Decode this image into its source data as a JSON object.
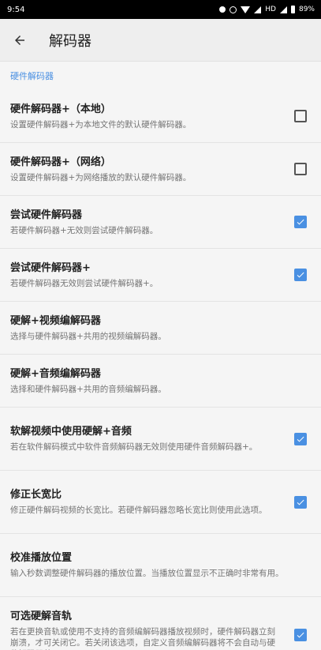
{
  "status_bar": {
    "time": "9:54",
    "network": "HD",
    "battery": "89%"
  },
  "app_bar": {
    "title": "解码器"
  },
  "section": {
    "header": "硬件解码器"
  },
  "colors": {
    "accent": "#4a90e2",
    "background": "#f5f5f5",
    "app_bar": "#eeeeee",
    "status_bar": "#000000"
  },
  "items": [
    {
      "title": "硬件解码器+（本地）",
      "summary": "设置硬件解码器+为本地文件的默认硬件解码器。",
      "checkbox": "unchecked"
    },
    {
      "title": "硬件解码器+（网络）",
      "summary": "设置硬件解码器+为网络播放的默认硬件解码器。",
      "checkbox": "unchecked"
    },
    {
      "title": "尝试硬件解码器",
      "summary": "若硬件解码器+无效则尝试硬件解码器。",
      "checkbox": "checked"
    },
    {
      "title": "尝试硬件解码器+",
      "summary": "若硬件解码器无效则尝试硬件解码器+。",
      "checkbox": "checked"
    },
    {
      "title": "硬解+视频编解码器",
      "summary": "选择与硬件解码器+共用的视频编解码器。",
      "checkbox": "none"
    },
    {
      "title": "硬解+音频编解码器",
      "summary": "选择和硬件解码器+共用的音频编解码器。",
      "checkbox": "none"
    },
    {
      "title": "软解视频中使用硬解+音频",
      "summary": "若在软件解码模式中软件音频解码器无效则使用硬件音频解码器+。",
      "checkbox": "checked"
    },
    {
      "title": "修正长宽比",
      "summary": "修正硬件解码视频的长宽比。若硬件解码器忽略长宽比则使用此选项。",
      "checkbox": "checked"
    },
    {
      "title": "校准播放位置",
      "summary": "输入秒数调整硬件解码器的播放位置。当播放位置显示不正确时非常有用。",
      "checkbox": "none"
    },
    {
      "title": "可选硬解音轨",
      "summary": "若在更换音轨或使用不支持的音频编解码器播放视频时，硬件解码器立刻崩溃，才可关闭它。若关闭该选项，自定义音频编解码器将不会自动与硬件解码器共用。",
      "checkbox": "checked"
    }
  ]
}
